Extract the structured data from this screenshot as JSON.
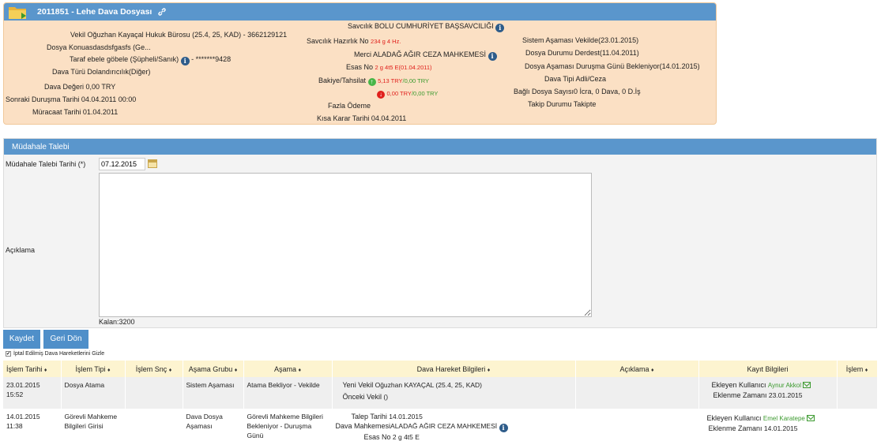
{
  "case": {
    "title": "2011851 - Lehe Dava Dosyası",
    "fields": {
      "vekil_k": "Vekil",
      "vekil_v": "Oğuzhan Kayaçal Hukuk Bürosu  (25.4, 25, KAD) - 3662129121",
      "konu_k": "Dosya Konu",
      "konu_v": "asdasdsfgasfs (Ge...",
      "taraf_k": "Taraf",
      "taraf_v": "ebele göbele (Şüpheli/Sanık)",
      "taraf_extra": " - *******9428",
      "tur_k": "Dava Türü",
      "tur_v": "Dolandırıcılık(Diğer)",
      "deger_k": "Dava Değeri",
      "deger_v": "0,00 TRY",
      "durusma_k": "Sonraki Duruşma Tarihi",
      "durusma_v": "04.04.2011 00:00",
      "muracaat_k": "Müracaat Tarihi",
      "muracaat_v": "01.04.2011",
      "savcilik_k": "Savcılık",
      "savcilik_v": "BOLU CUMHURİYET BAŞSAVCILIĞI",
      "hazirlik_k": "Savcılık Hazırlık No",
      "hazirlik_v": "234 g 4 Hz.",
      "merci_k": "Merci",
      "merci_v": "ALADAĞ AĞIR CEZA MAHKEMESİ",
      "esas_k": "Esas No",
      "esas_v": "2 g 4t5 E(01.04.2011)",
      "bakiye_k": "Bakiye/Tahsilat",
      "bakiye_up": "5,13 TRY",
      "bakiye_up2": "/0,00 TRY",
      "bakiye_down": "0,00 TRY",
      "bakiye_down2": "/0,00 TRY",
      "fazla_k": "Fazla Ödeme",
      "kisa_k": "Kısa Karar Tarihi",
      "kisa_v": "04.04.2011",
      "sistem_k": "Sistem Aşaması",
      "sistem_v": "Vekilde(23.01.2015)",
      "durum_k": "Dosya Durumu",
      "durum_v": "Derdest(11.04.2011)",
      "asama_k": "Dosya Aşaması",
      "asama_v": "Duruşma Günü Bekleniyor(14.01.2015)",
      "tip_k": "Dava Tipi",
      "tip_v": "Adli/Ceza",
      "bagli_k": "Bağlı Dosya Sayısı",
      "bagli_v": "0 İcra, 0 Dava, 0 D.İş",
      "takip_k": "Takip Durumu",
      "takip_v": "Takipte"
    }
  },
  "request": {
    "title": "Müdahale Talebi",
    "date_label": "Müdahale Talebi Tarihi (*)",
    "date_value": "07.12.2015",
    "desc_label": "Açıklama",
    "remaining": "Kalan:3200"
  },
  "buttons": {
    "save": "Kaydet",
    "back": "Geri Dön"
  },
  "hide_cancelled_label": "İptal Edilmiş Dava Hareketlerini Gizle",
  "table": {
    "headers": [
      "İşlem Tarihi",
      "İşlem Tipi",
      "İşlem Snç",
      "Aşama Grubu",
      "Aşama",
      "Dava Hareket Bilgileri",
      "Açıklama",
      "Kayıt Bilgileri",
      "İşlem"
    ],
    "sort_glyph": "♦",
    "rows": [
      {
        "date": "23.01.2015",
        "time": "15:52",
        "type": "Dosya Atama",
        "group": "Sistem Aşaması",
        "stage": "Atama Bekliyor - Vekilde",
        "info1_k": "Yeni Vekil",
        "info1_v": "Oğuzhan KAYAÇAL (25.4, 25, KAD)",
        "info2_k": "Önceki Vekil",
        "info2_v": "()",
        "adder_k": "Ekleyen Kullanıcı",
        "adder_v": "Aynur Akkol",
        "added_k": "Eklenme Zamanı",
        "added_v": "23.01.2015"
      },
      {
        "date": "14.01.2015",
        "time": "11:38",
        "type": "Görevli Mahkeme Bilgileri Girisi",
        "group": "Dava Dosya Aşaması",
        "stage": "Görevli Mahkeme Bilgileri Bekleniyor - Duruşma Günü",
        "info1_k": "Talep Tarihi",
        "info1_v": "14.01.2015",
        "info2_k": "Dava Mahkemesi",
        "info2_v": "ALADAĞ AĞIR CEZA MAHKEMESİ",
        "info3_k": "Esas No",
        "info3_v": "2 g 4t5 E",
        "adder_k": "Ekleyen Kullanıcı",
        "adder_v": "Emel Karatepe",
        "added_k": "Eklenme Zamanı",
        "added_v": "14.01.2015"
      }
    ]
  },
  "icons": [
    "folder-icon",
    "link-icon",
    "info-icon",
    "calendar-icon",
    "arrow-up-icon",
    "arrow-down-icon",
    "mail-icon",
    "checkbox-icon"
  ]
}
